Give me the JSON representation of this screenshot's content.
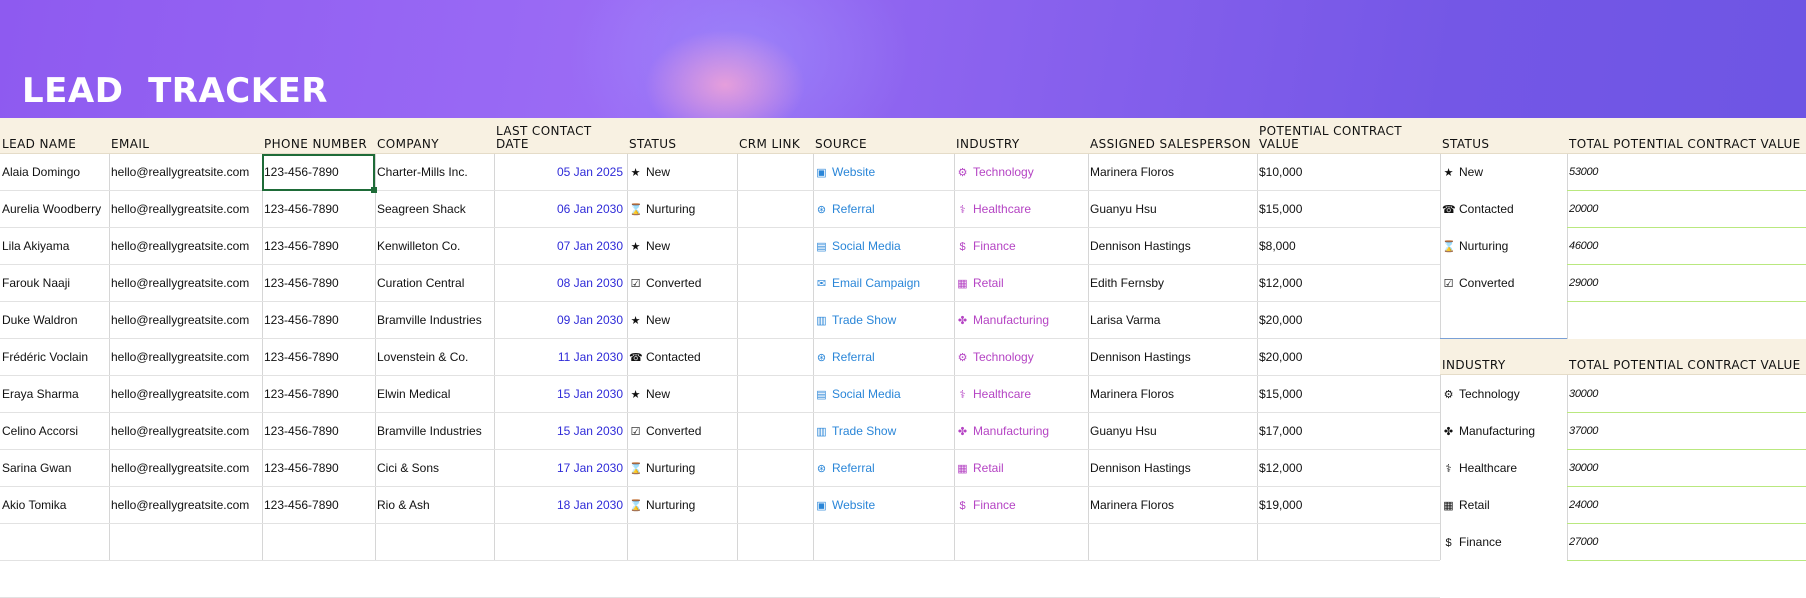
{
  "title": "LEAD  TRACKER",
  "headers": {
    "lead_name": "LEAD NAME",
    "email": "EMAIL",
    "phone": "PHONE NUMBER",
    "company": "COMPANY",
    "last_contact": "LAST CONTACT DATE",
    "status": "STATUS",
    "crm_link": "CRM LINK",
    "source": "SOURCE",
    "industry": "INDUSTRY",
    "salesperson": "ASSIGNED SALESPERSON",
    "value": "POTENTIAL CONTRACT VALUE"
  },
  "rows": [
    {
      "name": "Alaia Domingo",
      "email": "hello@reallygreatsite.com",
      "phone": "123-456-7890",
      "company": "Charter-Mills Inc.",
      "date": "05 Jan 2025",
      "status": "New",
      "status_icon": "star-icon",
      "source": "Website",
      "source_icon": "website-icon",
      "industry": "Technology",
      "industry_icon": "technology-icon",
      "salesperson": "Marinera Floros",
      "value": "$10,000"
    },
    {
      "name": "Aurelia Woodberry",
      "email": "hello@reallygreatsite.com",
      "phone": "123-456-7890",
      "company": "Seagreen Shack",
      "date": "06 Jan 2030",
      "status": "Nurturing",
      "status_icon": "hourglass-icon",
      "source": "Referral",
      "source_icon": "referral-icon",
      "industry": "Healthcare",
      "industry_icon": "healthcare-icon",
      "salesperson": "Guanyu Hsu",
      "value": "$15,000"
    },
    {
      "name": "Lila Akiyama",
      "email": "hello@reallygreatsite.com",
      "phone": "123-456-7890",
      "company": "Kenwilleton Co.",
      "date": "07 Jan 2030",
      "status": "New",
      "status_icon": "star-icon",
      "source": "Social Media",
      "source_icon": "social-media-icon",
      "industry": "Finance",
      "industry_icon": "dollar-icon",
      "salesperson": "Dennison Hastings",
      "value": "$8,000"
    },
    {
      "name": "Farouk Naaji",
      "email": "hello@reallygreatsite.com",
      "phone": "123-456-7890",
      "company": "Curation Central",
      "date": "08 Jan 2030",
      "status": "Converted",
      "status_icon": "checkbox-icon",
      "source": "Email Campaign",
      "source_icon": "email-icon",
      "industry": "Retail",
      "industry_icon": "cart-icon",
      "salesperson": "Edith Fernsby",
      "value": "$12,000"
    },
    {
      "name": "Duke Waldron",
      "email": "hello@reallygreatsite.com",
      "phone": "123-456-7890",
      "company": "Bramville Industries",
      "date": "09 Jan 2030",
      "status": "New",
      "status_icon": "star-icon",
      "source": "Trade Show",
      "source_icon": "trade-show-icon",
      "industry": "Manufacturing",
      "industry_icon": "manufacturing-icon",
      "salesperson": "Larisa Varma",
      "value": "$20,000"
    },
    {
      "name": "Frédéric Voclain",
      "email": "hello@reallygreatsite.com",
      "phone": "123-456-7890",
      "company": "Lovenstein & Co.",
      "date": "11 Jan 2030",
      "status": "Contacted",
      "status_icon": "phone-icon",
      "source": "Referral",
      "source_icon": "referral-icon",
      "industry": "Technology",
      "industry_icon": "technology-icon",
      "salesperson": "Dennison Hastings",
      "value": "$20,000"
    },
    {
      "name": "Eraya Sharma",
      "email": "hello@reallygreatsite.com",
      "phone": "123-456-7890",
      "company": "Elwin Medical",
      "date": "15 Jan 2030",
      "status": "New",
      "status_icon": "star-icon",
      "source": "Social Media",
      "source_icon": "social-media-icon",
      "industry": "Healthcare",
      "industry_icon": "healthcare-icon",
      "salesperson": "Marinera Floros",
      "value": "$15,000"
    },
    {
      "name": "Celino Accorsi",
      "email": "hello@reallygreatsite.com",
      "phone": "123-456-7890",
      "company": "Bramville Industries",
      "date": "15 Jan 2030",
      "status": "Converted",
      "status_icon": "checkbox-icon",
      "source": "Trade Show",
      "source_icon": "trade-show-icon",
      "industry": "Manufacturing",
      "industry_icon": "manufacturing-icon",
      "salesperson": "Guanyu Hsu",
      "value": "$17,000"
    },
    {
      "name": "Sarina Gwan",
      "email": "hello@reallygreatsite.com",
      "phone": "123-456-7890",
      "company": "Cici & Sons",
      "date": "17 Jan 2030",
      "status": "Nurturing",
      "status_icon": "hourglass-icon",
      "source": "Referral",
      "source_icon": "referral-icon",
      "industry": "Retail",
      "industry_icon": "cart-icon",
      "salesperson": "Dennison Hastings",
      "value": "$12,000"
    },
    {
      "name": "Akio Tomika",
      "email": "hello@reallygreatsite.com",
      "phone": "123-456-7890",
      "company": "Rio & Ash",
      "date": "18 Jan 2030",
      "status": "Nurturing",
      "status_icon": "hourglass-icon",
      "source": "Website",
      "source_icon": "website-icon",
      "industry": "Finance",
      "industry_icon": "dollar-icon",
      "salesperson": "Marinera Floros",
      "value": "$19,000"
    }
  ],
  "status_summary": {
    "header_status": "STATUS",
    "header_value": "TOTAL POTENTIAL CONTRACT VALUE",
    "items": [
      {
        "label": "New",
        "icon": "star-icon",
        "value": "53000"
      },
      {
        "label": "Contacted",
        "icon": "phone-icon",
        "value": "20000"
      },
      {
        "label": "Nurturing",
        "icon": "hourglass-icon",
        "value": "46000"
      },
      {
        "label": "Converted",
        "icon": "checkbox-icon",
        "value": "29000"
      }
    ]
  },
  "industry_summary": {
    "header_industry": "INDUSTRY",
    "header_value": "TOTAL POTENTIAL CONTRACT VALUE",
    "items": [
      {
        "label": "Technology",
        "icon": "technology-icon",
        "value": "30000"
      },
      {
        "label": "Manufacturing",
        "icon": "manufacturing-icon",
        "value": "37000"
      },
      {
        "label": "Healthcare",
        "icon": "healthcare-icon",
        "value": "30000"
      },
      {
        "label": "Retail",
        "icon": "cart-icon",
        "value": "24000"
      },
      {
        "label": "Finance",
        "icon": "dollar-icon",
        "value": "27000"
      }
    ]
  },
  "colors": {
    "header_bg": "#f8f1e2",
    "date_text": "#2f2bd8",
    "link_blue": "#2a86d8",
    "industry_magenta": "#b544c4",
    "selection": "#1e6b38"
  }
}
